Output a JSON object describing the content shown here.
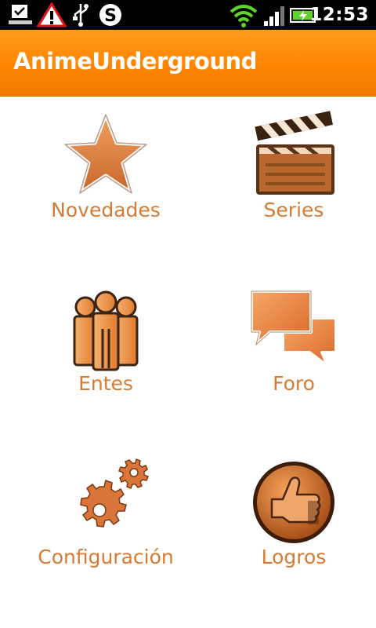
{
  "status_bar": {
    "time": "12:53",
    "icons": [
      "download-complete-icon",
      "warning-icon",
      "usb-icon",
      "skype-icon",
      "wifi-icon",
      "signal-icon",
      "battery-charging-icon"
    ]
  },
  "app_bar": {
    "title": "AnimeUnderground"
  },
  "menu": [
    {
      "label": "Novedades",
      "icon": "star-icon"
    },
    {
      "label": "Series",
      "icon": "clapperboard-icon"
    },
    {
      "label": "Entes",
      "icon": "people-icon"
    },
    {
      "label": "Foro",
      "icon": "chat-bubbles-icon"
    },
    {
      "label": "Configuración",
      "icon": "gears-icon"
    },
    {
      "label": "Logros",
      "icon": "thumbs-up-icon"
    }
  ],
  "colors": {
    "accent": "#ff8c00",
    "label": "#d77a33",
    "icon_fill": "#d9753a"
  }
}
